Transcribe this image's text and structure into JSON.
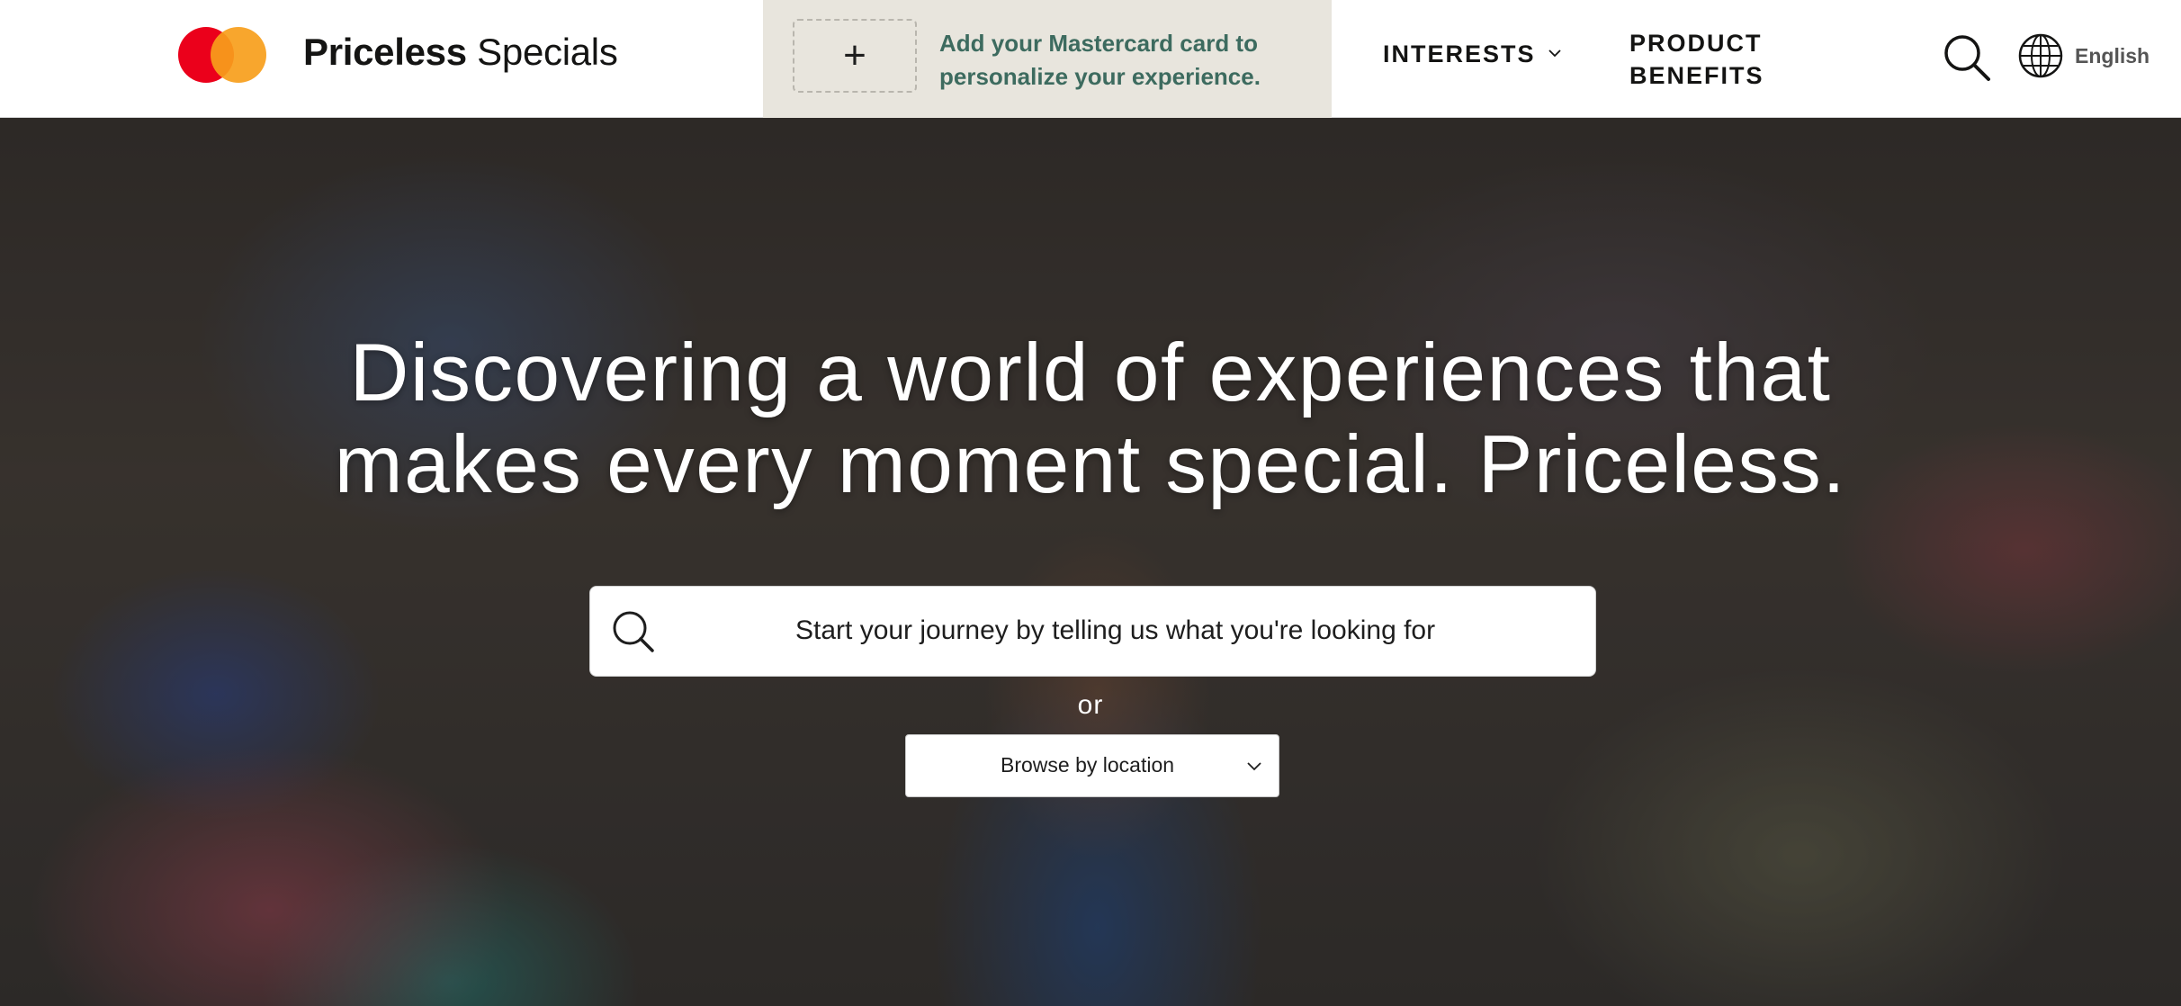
{
  "header": {
    "brand_bold": "Priceless",
    "brand_light": " Specials",
    "add_card_label": "+",
    "promo_text": "Add your Mastercard card to personalize your experience.",
    "nav_interests": "INTERESTS",
    "nav_benefits_line1": "PRODUCT",
    "nav_benefits_line2": "BENEFITS",
    "language": "English"
  },
  "hero": {
    "title_line1": "Discovering a world of experiences that",
    "title_line2": "makes every moment special. Priceless.",
    "search_placeholder": "Start your journey by telling us what you're looking for",
    "or_text": "or",
    "browse_label": "Browse by location"
  },
  "icons": [
    "mastercard-logo-icon",
    "plus-icon",
    "chevron-down-icon",
    "search-icon",
    "globe-icon"
  ],
  "colors": {
    "mastercard_red": "#eb001b",
    "mastercard_orange": "#f79e1b",
    "promo_bg": "#e8e5dd",
    "promo_text": "#3d6b5f",
    "nav_text": "#141413"
  }
}
